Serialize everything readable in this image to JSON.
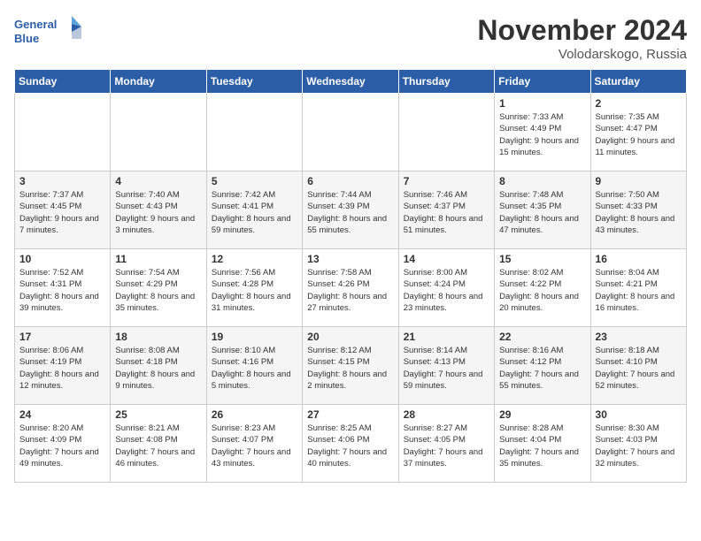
{
  "header": {
    "logo_line1": "General",
    "logo_line2": "Blue",
    "month_title": "November 2024",
    "location": "Volodarskogo, Russia"
  },
  "weekdays": [
    "Sunday",
    "Monday",
    "Tuesday",
    "Wednesday",
    "Thursday",
    "Friday",
    "Saturday"
  ],
  "weeks": [
    [
      {
        "day": "",
        "text": ""
      },
      {
        "day": "",
        "text": ""
      },
      {
        "day": "",
        "text": ""
      },
      {
        "day": "",
        "text": ""
      },
      {
        "day": "",
        "text": ""
      },
      {
        "day": "1",
        "text": "Sunrise: 7:33 AM\nSunset: 4:49 PM\nDaylight: 9 hours and 15 minutes."
      },
      {
        "day": "2",
        "text": "Sunrise: 7:35 AM\nSunset: 4:47 PM\nDaylight: 9 hours and 11 minutes."
      }
    ],
    [
      {
        "day": "3",
        "text": "Sunrise: 7:37 AM\nSunset: 4:45 PM\nDaylight: 9 hours and 7 minutes."
      },
      {
        "day": "4",
        "text": "Sunrise: 7:40 AM\nSunset: 4:43 PM\nDaylight: 9 hours and 3 minutes."
      },
      {
        "day": "5",
        "text": "Sunrise: 7:42 AM\nSunset: 4:41 PM\nDaylight: 8 hours and 59 minutes."
      },
      {
        "day": "6",
        "text": "Sunrise: 7:44 AM\nSunset: 4:39 PM\nDaylight: 8 hours and 55 minutes."
      },
      {
        "day": "7",
        "text": "Sunrise: 7:46 AM\nSunset: 4:37 PM\nDaylight: 8 hours and 51 minutes."
      },
      {
        "day": "8",
        "text": "Sunrise: 7:48 AM\nSunset: 4:35 PM\nDaylight: 8 hours and 47 minutes."
      },
      {
        "day": "9",
        "text": "Sunrise: 7:50 AM\nSunset: 4:33 PM\nDaylight: 8 hours and 43 minutes."
      }
    ],
    [
      {
        "day": "10",
        "text": "Sunrise: 7:52 AM\nSunset: 4:31 PM\nDaylight: 8 hours and 39 minutes."
      },
      {
        "day": "11",
        "text": "Sunrise: 7:54 AM\nSunset: 4:29 PM\nDaylight: 8 hours and 35 minutes."
      },
      {
        "day": "12",
        "text": "Sunrise: 7:56 AM\nSunset: 4:28 PM\nDaylight: 8 hours and 31 minutes."
      },
      {
        "day": "13",
        "text": "Sunrise: 7:58 AM\nSunset: 4:26 PM\nDaylight: 8 hours and 27 minutes."
      },
      {
        "day": "14",
        "text": "Sunrise: 8:00 AM\nSunset: 4:24 PM\nDaylight: 8 hours and 23 minutes."
      },
      {
        "day": "15",
        "text": "Sunrise: 8:02 AM\nSunset: 4:22 PM\nDaylight: 8 hours and 20 minutes."
      },
      {
        "day": "16",
        "text": "Sunrise: 8:04 AM\nSunset: 4:21 PM\nDaylight: 8 hours and 16 minutes."
      }
    ],
    [
      {
        "day": "17",
        "text": "Sunrise: 8:06 AM\nSunset: 4:19 PM\nDaylight: 8 hours and 12 minutes."
      },
      {
        "day": "18",
        "text": "Sunrise: 8:08 AM\nSunset: 4:18 PM\nDaylight: 8 hours and 9 minutes."
      },
      {
        "day": "19",
        "text": "Sunrise: 8:10 AM\nSunset: 4:16 PM\nDaylight: 8 hours and 5 minutes."
      },
      {
        "day": "20",
        "text": "Sunrise: 8:12 AM\nSunset: 4:15 PM\nDaylight: 8 hours and 2 minutes."
      },
      {
        "day": "21",
        "text": "Sunrise: 8:14 AM\nSunset: 4:13 PM\nDaylight: 7 hours and 59 minutes."
      },
      {
        "day": "22",
        "text": "Sunrise: 8:16 AM\nSunset: 4:12 PM\nDaylight: 7 hours and 55 minutes."
      },
      {
        "day": "23",
        "text": "Sunrise: 8:18 AM\nSunset: 4:10 PM\nDaylight: 7 hours and 52 minutes."
      }
    ],
    [
      {
        "day": "24",
        "text": "Sunrise: 8:20 AM\nSunset: 4:09 PM\nDaylight: 7 hours and 49 minutes."
      },
      {
        "day": "25",
        "text": "Sunrise: 8:21 AM\nSunset: 4:08 PM\nDaylight: 7 hours and 46 minutes."
      },
      {
        "day": "26",
        "text": "Sunrise: 8:23 AM\nSunset: 4:07 PM\nDaylight: 7 hours and 43 minutes."
      },
      {
        "day": "27",
        "text": "Sunrise: 8:25 AM\nSunset: 4:06 PM\nDaylight: 7 hours and 40 minutes."
      },
      {
        "day": "28",
        "text": "Sunrise: 8:27 AM\nSunset: 4:05 PM\nDaylight: 7 hours and 37 minutes."
      },
      {
        "day": "29",
        "text": "Sunrise: 8:28 AM\nSunset: 4:04 PM\nDaylight: 7 hours and 35 minutes."
      },
      {
        "day": "30",
        "text": "Sunrise: 8:30 AM\nSunset: 4:03 PM\nDaylight: 7 hours and 32 minutes."
      }
    ]
  ]
}
